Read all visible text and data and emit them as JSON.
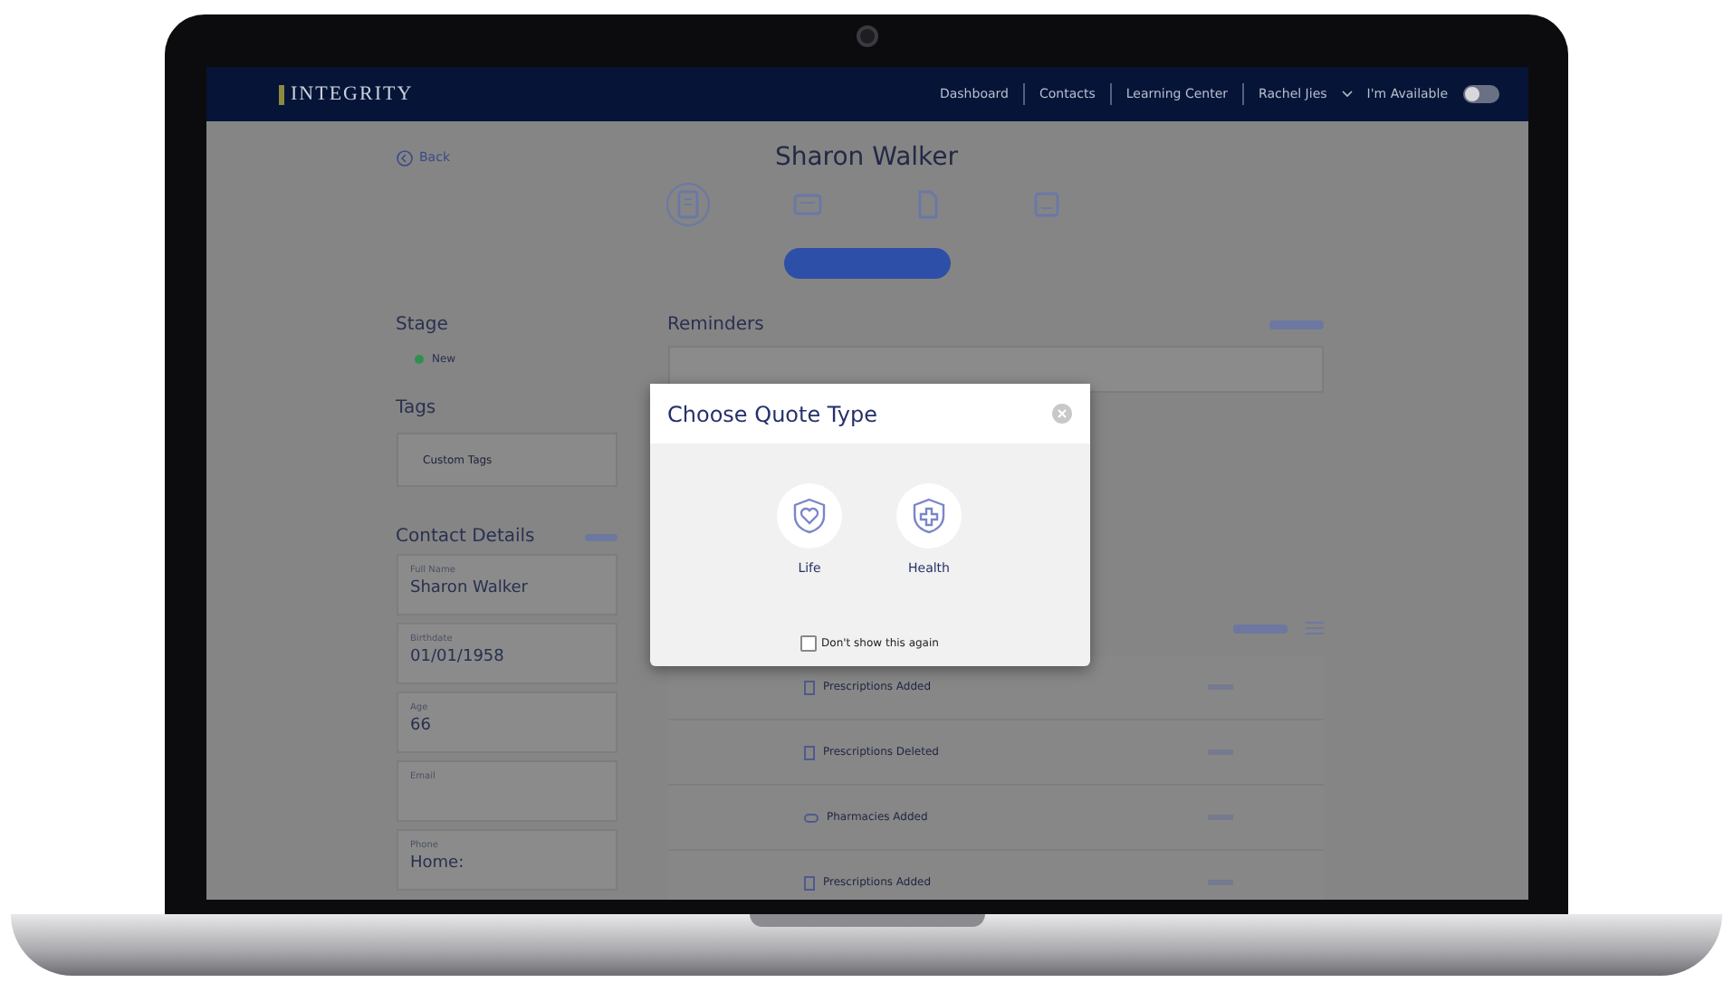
{
  "header": {
    "logo": "INTEGRITY",
    "nav": [
      {
        "label": "Dashboard"
      },
      {
        "label": "Contacts"
      },
      {
        "label": "Learning Center"
      }
    ],
    "user": "Rachel Jies",
    "availability": {
      "label": "I'm Available",
      "on": false
    }
  },
  "contact": {
    "back": "Back",
    "name": "Sharon Walker"
  },
  "tabs": [
    {
      "kind": "overview",
      "selected": true
    },
    {
      "kind": "profile",
      "selected": false
    },
    {
      "kind": "policy",
      "selected": false
    },
    {
      "kind": "notes",
      "selected": false
    }
  ],
  "stage": {
    "title": "Stage",
    "value": "New"
  },
  "tags": {
    "title": "Tags",
    "items": [
      "Custom Tags"
    ]
  },
  "contact_details": {
    "title": "Contact Details",
    "fields": [
      {
        "label": "Full Name",
        "value": "Sharon Walker"
      },
      {
        "label": "Birthdate",
        "value": "01/01/1958"
      },
      {
        "label": "Age",
        "value": "66"
      },
      {
        "label": "Email"
      },
      {
        "label": "Phone",
        "value": "Home:"
      }
    ]
  },
  "reminders": {
    "title": "Reminders"
  },
  "activity": [
    {
      "kind": "prescription",
      "title": "Prescriptions Added"
    },
    {
      "kind": "prescription",
      "title": "Prescriptions Deleted"
    },
    {
      "kind": "pharmacy",
      "title": "Pharmacies Added"
    },
    {
      "kind": "prescription",
      "title": "Prescriptions Added"
    }
  ],
  "modal": {
    "title": "Choose Quote Type",
    "options": [
      {
        "kind": "life",
        "label": "Life"
      },
      {
        "kind": "health",
        "label": "Health"
      }
    ],
    "dont_show_again": {
      "label": "Don't show this again",
      "checked": false
    }
  }
}
